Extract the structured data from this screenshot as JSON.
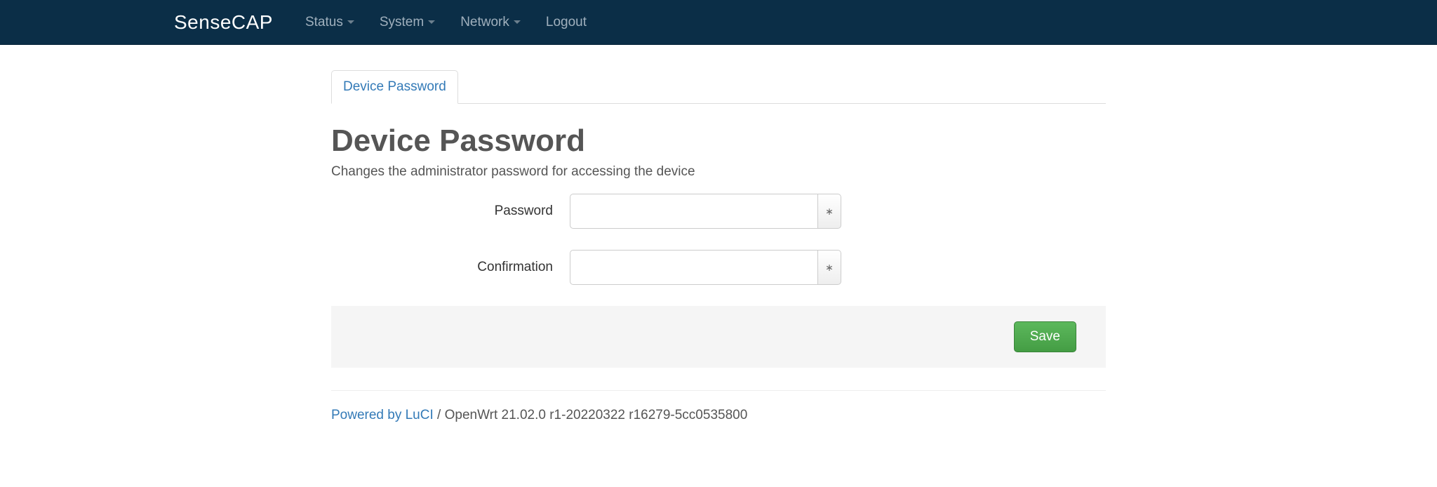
{
  "navbar": {
    "brand": "SenseCAP",
    "items": [
      {
        "label": "Status",
        "dropdown": true
      },
      {
        "label": "System",
        "dropdown": true
      },
      {
        "label": "Network",
        "dropdown": true
      },
      {
        "label": "Logout",
        "dropdown": false
      }
    ]
  },
  "tabs": [
    {
      "label": "Device Password",
      "active": true
    }
  ],
  "page": {
    "title": "Device Password",
    "subtitle": "Changes the administrator password for accessing the device"
  },
  "form": {
    "password": {
      "label": "Password",
      "value": "",
      "reveal_symbol": "∗"
    },
    "confirmation": {
      "label": "Confirmation",
      "value": "",
      "reveal_symbol": "∗"
    }
  },
  "actions": {
    "save_label": "Save"
  },
  "footer": {
    "link_text": "Powered by LuCI",
    "separator": " / ",
    "version_text": "OpenWrt 21.02.0 r1-20220322 r16279-5cc0535800"
  }
}
